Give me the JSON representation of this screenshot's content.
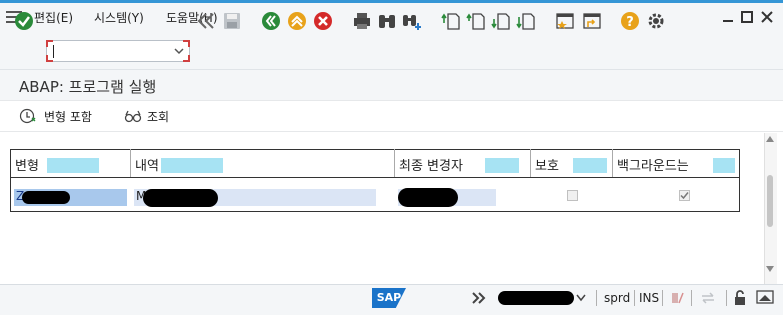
{
  "menu": {
    "edit": "편집(E)",
    "system": "시스템(Y)",
    "help": "도움말(H)"
  },
  "page": {
    "title": "ABAP: 프로그램 실행"
  },
  "app_toolbar": {
    "include_variants": "변형 포함",
    "display": "조회"
  },
  "table": {
    "columns": [
      "변형",
      "내역",
      "최종 변경자",
      "보호",
      "백그라운드는"
    ],
    "rows": [
      {
        "variant": "Z",
        "description": "M",
        "last_changed_by": "",
        "protected": false,
        "background": true
      }
    ]
  },
  "status_bar": {
    "logo": "SAP",
    "client": "sprd",
    "mode": "INS"
  },
  "icons": [
    "enter-icon",
    "back-icon",
    "save-icon",
    "exit-icon",
    "cancel-icon",
    "print-icon",
    "find-icon",
    "find-next-icon",
    "first-page-icon",
    "prev-page-icon",
    "next-page-icon",
    "last-page-icon",
    "new-session-icon",
    "shortcut-icon",
    "help-icon",
    "settings-icon"
  ]
}
